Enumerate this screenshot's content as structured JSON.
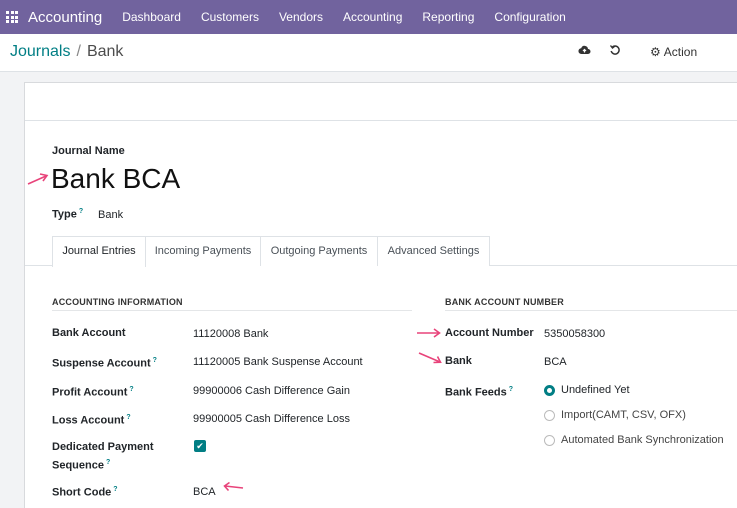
{
  "topbar": {
    "app_name": "Accounting",
    "menu": [
      "Dashboard",
      "Customers",
      "Vendors",
      "Accounting",
      "Reporting",
      "Configuration"
    ]
  },
  "breadcrumb": {
    "parent": "Journals",
    "separator": "/",
    "current": "Bank"
  },
  "toolbar": {
    "action_label": "Action",
    "save_icon": "cloud-upload-icon",
    "discard_icon": "undo-icon"
  },
  "journal": {
    "name_label": "Journal Name",
    "name": "Bank BCA",
    "type_label": "Type",
    "type_value": "Bank",
    "help_mark": "?"
  },
  "tabs": [
    "Journal Entries",
    "Incoming Payments",
    "Outgoing Payments",
    "Advanced Settings"
  ],
  "accounting_info": {
    "title": "ACCOUNTING INFORMATION",
    "bank_account_label": "Bank Account",
    "bank_account_value": "11120008 Bank",
    "suspense_label": "Suspense Account",
    "suspense_value": "11120005 Bank Suspense Account",
    "profit_label": "Profit Account",
    "profit_value": "99900006 Cash Difference Gain",
    "loss_label": "Loss Account",
    "loss_value": "99900005 Cash Difference Loss",
    "dedicated_label_1": "Dedicated Payment",
    "dedicated_label_2": "Sequence",
    "dedicated_checked": true,
    "short_code_label": "Short Code",
    "short_code_value": "BCA"
  },
  "bank_account_number": {
    "title": "BANK ACCOUNT NUMBER",
    "account_number_label": "Account Number",
    "account_number_value": "5350058300",
    "bank_label": "Bank",
    "bank_value": "BCA",
    "feeds_label": "Bank Feeds",
    "feeds_options": [
      "Undefined Yet",
      "Import(CAMT, CSV, OFX)",
      "Automated Bank Synchronization"
    ],
    "feeds_selected": "Undefined Yet"
  },
  "colors": {
    "topbar": "#71639e",
    "accent": "#017e84",
    "annotation_arrow": "#e8437a"
  }
}
